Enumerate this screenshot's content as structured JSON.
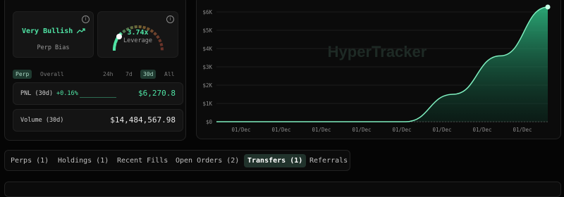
{
  "stats": {
    "bias": {
      "value": "Very Bullish",
      "label": "Perp Bias",
      "trend_icon": "trend-up-icon"
    },
    "leverage": {
      "value": "3.74x",
      "label": "Leverage",
      "level": 0.62
    },
    "info_glyph": "i"
  },
  "filters": {
    "type_tabs": [
      "Perp",
      "Overall"
    ],
    "type_active": "Perp",
    "range_tabs": [
      "24h",
      "7d",
      "30d",
      "All"
    ],
    "range_active": "30d"
  },
  "pnl": {
    "label": "PNL (30d)",
    "change": "+0.16%",
    "value": "$6,270.8"
  },
  "volume": {
    "label": "Volume (30d)",
    "value": "$14,484,567.98"
  },
  "chart_data": {
    "type": "area",
    "x": [
      "01/Dec",
      "01/Dec",
      "01/Dec",
      "01/Dec",
      "01/Dec",
      "01/Dec",
      "01/Dec",
      "01/Dec"
    ],
    "series": [
      {
        "values": [
          0,
          0,
          0,
          0,
          0,
          1500,
          3600,
          6270.8
        ]
      }
    ],
    "ylim": [
      0,
      6000
    ],
    "yticks": [
      "$6K",
      "$5K",
      "$4K",
      "$3K",
      "$2K",
      "$1K",
      "$0"
    ],
    "watermark": "HyperTracker",
    "accent": "#4fe3a4"
  },
  "tabs": [
    "Perps (1)",
    "Holdings (1)",
    "Recent Fills",
    "Open Orders (2)",
    "Transfers (1)",
    "Referrals"
  ],
  "tabs_active": "Transfers (1)"
}
